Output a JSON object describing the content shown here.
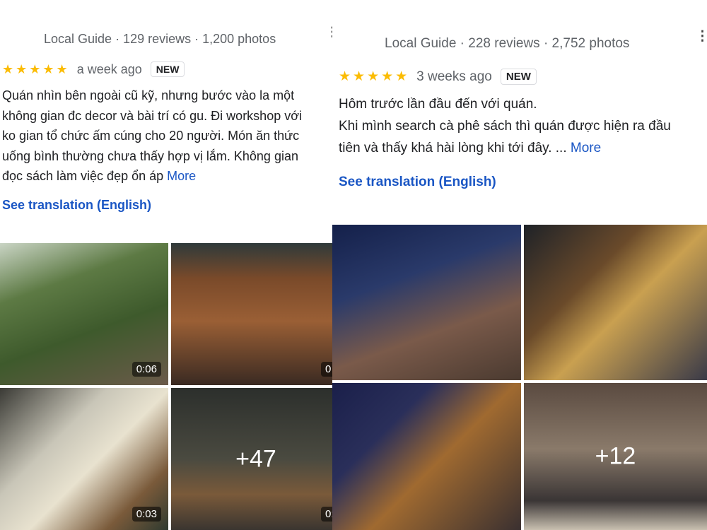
{
  "reviews": [
    {
      "meta": "Local Guide · 129 reviews · 1,200 photos",
      "stars": "★★★★★",
      "rating": 5,
      "time": "a week ago",
      "badge": "NEW",
      "lines": [
        "Quán nhìn bên ngoài cũ kỹ, nhưng bước vào la một",
        "không gian đc decor và bài trí có gu. Đi workshop với",
        "ko gian tổ chức ấm cúng cho 20 người. Món ăn thức",
        "uống bình thường chưa thấy hợp vị lắm. Không gian",
        "đọc sách làm việc đẹp ổn áp"
      ],
      "more": "More",
      "translation": "See translation (English)",
      "photos": [
        {
          "duration": "0:06"
        },
        {
          "duration": "0"
        },
        {
          "duration": "0:03"
        },
        {
          "overlay": "+47",
          "duration": "0:"
        }
      ]
    },
    {
      "meta": "Local Guide · 228 reviews · 2,752 photos",
      "stars": "★★★★★",
      "rating": 5,
      "time": "3 weeks ago",
      "badge": "NEW",
      "lines": [
        "Hôm trước lần đầu đến với quán.",
        "Khi mình search cà phê sách thì quán được hiện ra đầu",
        "tiên và thấy khá hài lòng khi tới đây. ..."
      ],
      "more": "More",
      "translation": "See translation (English)",
      "photos": [
        {},
        {},
        {},
        {
          "overlay": "+12"
        }
      ]
    }
  ]
}
